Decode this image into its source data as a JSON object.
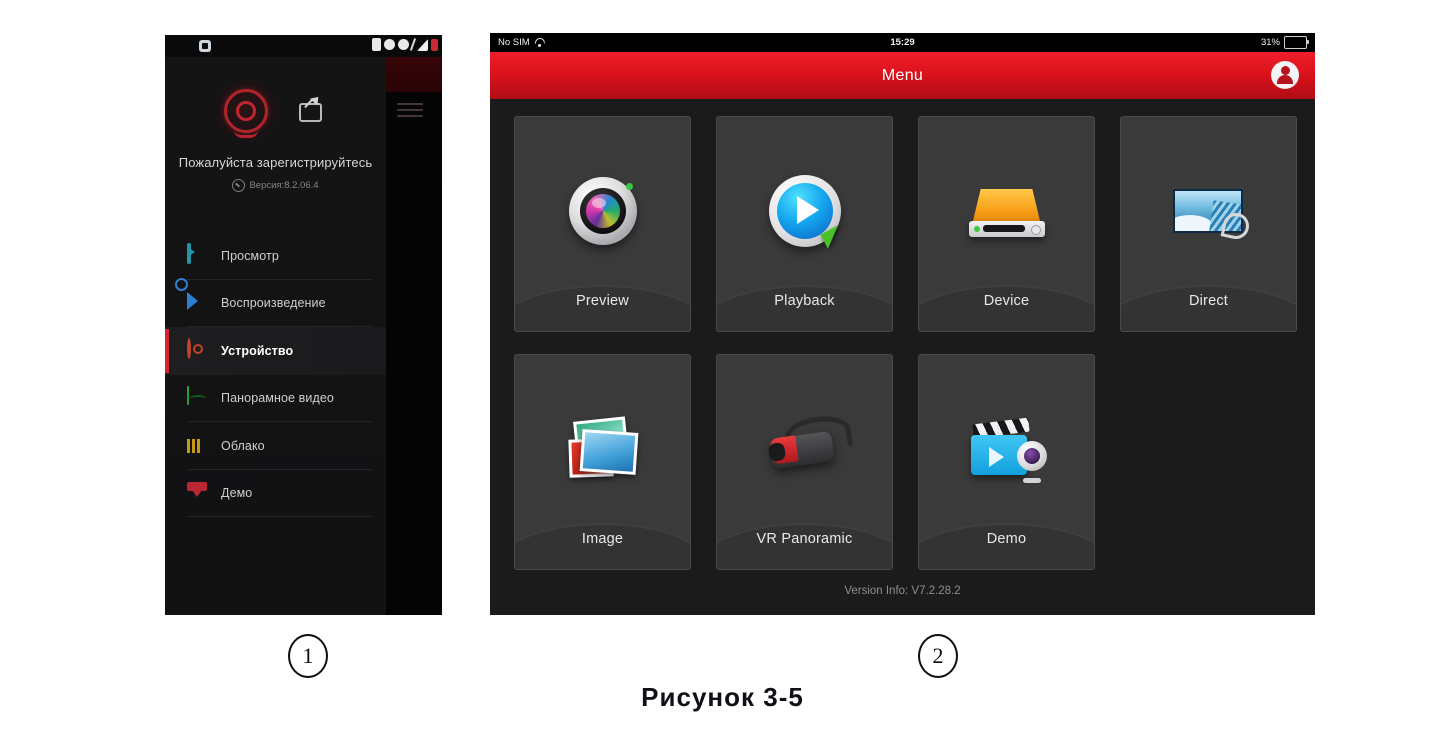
{
  "left_panel": {
    "status_bar": {
      "carrier": "",
      "icons": [
        "sim-icon",
        "signal-icon",
        "circle-icon",
        "slash-icon",
        "triangle-icon"
      ],
      "battery_label": ""
    },
    "behind_header": {
      "menu_icon": "hamburger-icon"
    },
    "account": {
      "logo": "camera-logo-icon",
      "share_icon": "share-icon",
      "register_prompt": "Пожалуйста зарегистрируйтесь",
      "version_label": "Версия:8.2.06.4"
    },
    "menu_items": [
      {
        "label": "Просмотр",
        "icon": "preview-icon",
        "color": "#2593a8",
        "active": false
      },
      {
        "label": "Воспроизведение",
        "icon": "playback-icon",
        "color": "#2f7fd0",
        "active": false
      },
      {
        "label": "Устройство",
        "icon": "device-icon",
        "color": "#c0452c",
        "active": true
      },
      {
        "label": "Панорамное видео",
        "icon": "panorama-icon",
        "color": "#1e8a2e",
        "active": false
      },
      {
        "label": "Облако",
        "icon": "cloud-icon",
        "color": "#c79a16",
        "active": false
      },
      {
        "label": "Демо",
        "icon": "demo-icon",
        "color": "#b92731",
        "active": false
      }
    ]
  },
  "right_panel": {
    "status_bar": {
      "carrier": "No SIM",
      "wifi_icon": "wifi-icon",
      "time": "15:29",
      "battery_percent": "31%"
    },
    "header": {
      "title": "Menu",
      "account_icon": "account-icon"
    },
    "tiles": [
      {
        "label": "Preview",
        "icon": "camera-lens-icon"
      },
      {
        "label": "Playback",
        "icon": "play-button-icon"
      },
      {
        "label": "Device",
        "icon": "hard-drive-icon"
      },
      {
        "label": "Direct",
        "icon": "monitor-image-icon"
      },
      {
        "label": "Image",
        "icon": "photos-stack-icon"
      },
      {
        "label": "VR Panoramic",
        "icon": "vr-headset-icon"
      },
      {
        "label": "Demo",
        "icon": "clapperboard-camera-icon"
      }
    ],
    "version_info": "Version Info: V7.2.28.2"
  },
  "annotations": {
    "marker_one": "1",
    "marker_two": "2",
    "figure_caption": "Рисунок  3-5"
  },
  "colors": {
    "brand_red": "#d9121c",
    "accent_active": "#d42630",
    "panel_dark": "#1b1b1c",
    "tile_bg": "#3a3a3b"
  }
}
